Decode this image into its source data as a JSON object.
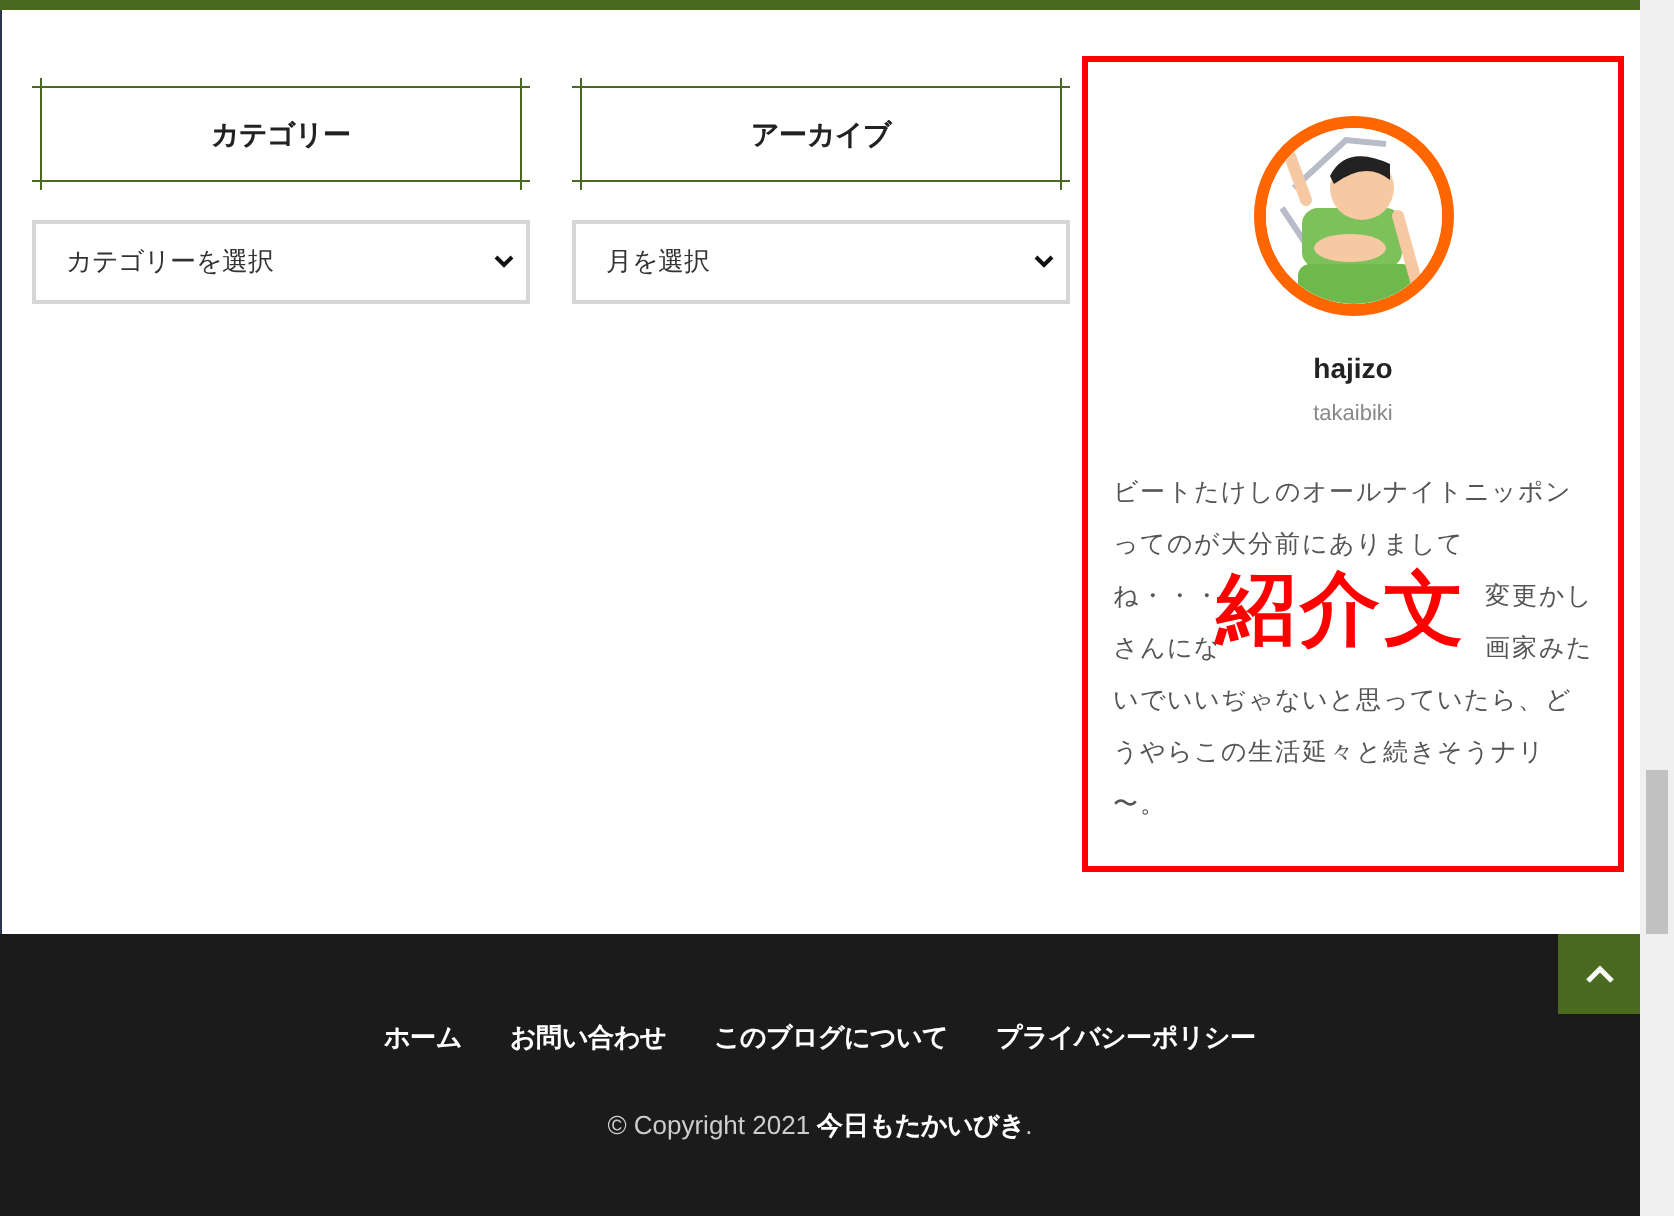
{
  "widgets": [
    {
      "title": "カテゴリー",
      "select": "カテゴリーを選択"
    },
    {
      "title": "アーカイブ",
      "select": "月を選択"
    }
  ],
  "profile": {
    "name": "hajizo",
    "handle": "takaibiki",
    "bio_lines": [
      [
        "ビートたけしのオールナイトニッポン"
      ],
      [
        "ってのが大分前にありまして"
      ],
      [
        "ね・・・",
        "変更かし"
      ],
      [
        "さんにな",
        "画家みた"
      ],
      [
        "いでいいぢゃないと思っていたら、ど"
      ],
      [
        "うやらこの生活延々と続きそうナリ"
      ],
      [
        "〜。"
      ]
    ],
    "overlay_label": "紹介文"
  },
  "footer": {
    "nav": [
      {
        "label": "ホーム"
      },
      {
        "label": "お問い合わせ"
      },
      {
        "label": "このブログについて"
      },
      {
        "label": "プライバシーポリシー"
      }
    ],
    "copyright": "© Copyright 2021 ",
    "site_name": "今日もたかいびき",
    "period": "."
  }
}
